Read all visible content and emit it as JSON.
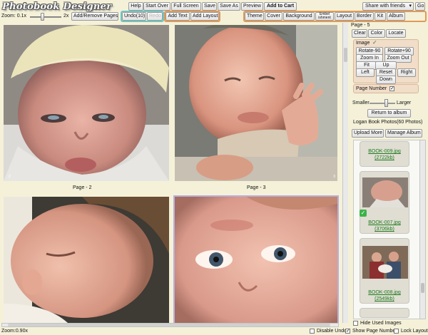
{
  "app": {
    "title": "Photobook Designer"
  },
  "toolbar": {
    "help": "Help",
    "start_over": "Start Over",
    "full_screen": "Full Screen",
    "save": "Save",
    "save_as": "Save As",
    "preview": "Preview",
    "add_to_cart": "Add to Cart",
    "share_select": "Share with friends",
    "go": "Go",
    "zoom_label": "Zoom: 0.1x",
    "zoom_max": "2x",
    "add_remove_pages": "Add/Remove Pages",
    "undo": "Undo(10)",
    "redo": "Redo",
    "add_text": "Add Text",
    "add_layout": "Add Layout",
    "tabs": [
      "Theme",
      "Cover",
      "Background",
      "Embellishment",
      "Layout",
      "Border",
      "Kit",
      "Album"
    ],
    "embellishment_short": [
      "Embel",
      "ishment"
    ]
  },
  "pages": {
    "left_label": "Page - 2",
    "right_label": "Page - 3",
    "left_page_number": "2",
    "right_page_number": "3"
  },
  "panel": {
    "page_title": "Page - 5",
    "clear": "Clear",
    "color": "Color",
    "locate": "Locate",
    "image_label": "Image",
    "rotate_left": "Rotate-90",
    "rotate_right": "Rotate+90",
    "zoom_in": "Zoom In",
    "zoom_out": "Zoom Out",
    "fit": "Fit",
    "up": "Up",
    "left": "Left",
    "reset": "Reset",
    "right": "Right",
    "down": "Down",
    "page_number": "Page Number",
    "smaller": "Smaller",
    "larger": "Larger",
    "return_album": "Return to album",
    "album_title": "Logan Book Photos(60 Photos)",
    "upload_more": "Upload More",
    "manage_album": "Manage Album",
    "hide_used": "Hide Used Images"
  },
  "thumbs": [
    {
      "name": "BOOK-009.jpg",
      "size": "(2722kb)"
    },
    {
      "name": "BOOK-007.jpg",
      "size": "(3706kb)"
    },
    {
      "name": "BOOK-008.jpg",
      "size": "(2549kb)"
    }
  ],
  "status": {
    "zoom": "Zoom:0.90x",
    "disable_undo": "Disable Undo",
    "show_page_number": "Show Page Number",
    "lock_layout": "Lock Layout"
  },
  "colors": {
    "bg": "#f4f1d8",
    "group_blue": "#7fb4d6",
    "group_orange": "#e39a55",
    "group_teal": "#6fc6c0",
    "link_green": "#1b7a1b"
  }
}
